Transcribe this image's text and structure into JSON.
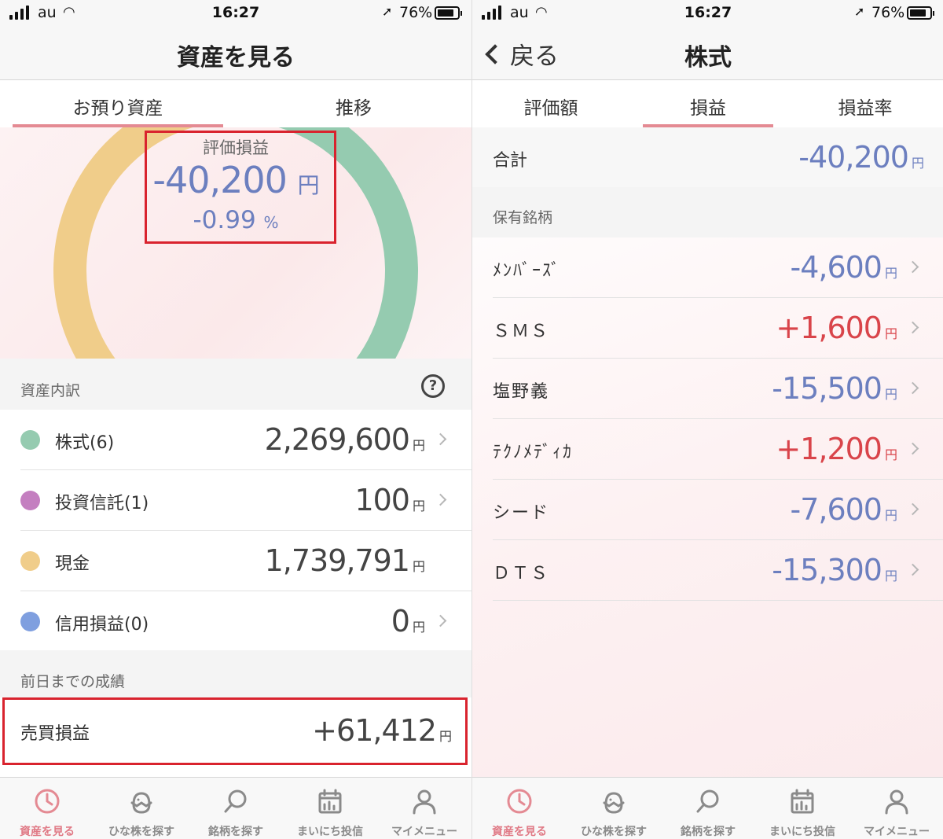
{
  "colors": {
    "accent": "#e48a93",
    "negative": "#6c7fbf",
    "positive": "#d9444a",
    "highlight_box": "#d9232e",
    "stocks": "#95cbb0",
    "funds": "#c47fc0",
    "cash": "#f0cd8a",
    "margin": "#7f9fdf"
  },
  "status": {
    "carrier": "au",
    "time": "16:27",
    "battery": "76%"
  },
  "left": {
    "title": "資産を見る",
    "tabs": [
      {
        "label": "お預り資産",
        "active": true
      },
      {
        "label": "推移",
        "active": false
      }
    ],
    "valuation": {
      "label": "評価損益",
      "amount": "-40,200",
      "unit": "円",
      "rate": "-0.99",
      "rate_unit": "%"
    },
    "donut": [
      {
        "name": "株式",
        "fraction": 0.566,
        "color": "#95cbb0"
      },
      {
        "name": "現金",
        "fraction": 0.434,
        "color": "#f0cd8a"
      }
    ],
    "breakdown": {
      "header": "資産内訳",
      "help_icon": "?",
      "items": [
        {
          "label": "株式(6)",
          "value": "2,269,600",
          "unit": "円",
          "color": "#95cbb0"
        },
        {
          "label": "投資信託(1)",
          "value": "100",
          "unit": "円",
          "color": "#c47fc0"
        },
        {
          "label": "現金",
          "value": "1,739,791",
          "unit": "円",
          "color": "#f0cd8a"
        },
        {
          "label": "信用損益(0)",
          "value": "0",
          "unit": "円",
          "color": "#7f9fdf"
        }
      ]
    },
    "results": {
      "header": "前日までの成績",
      "label": "売買損益",
      "value": "+61,412",
      "unit": "円"
    }
  },
  "right": {
    "back_label": "戻る",
    "title": "株式",
    "tabs": [
      {
        "label": "評価額",
        "active": false
      },
      {
        "label": "損益",
        "active": true
      },
      {
        "label": "損益率",
        "active": false
      }
    ],
    "total": {
      "label": "合計",
      "value": "-40,200",
      "unit": "円"
    },
    "holdings_header": "保有銘柄",
    "holdings": [
      {
        "name": "ﾒﾝﾊﾞｰｽﾞ",
        "value": "-4,600",
        "unit": "円",
        "sign": "neg"
      },
      {
        "name": "ＳＭＳ",
        "value": "+1,600",
        "unit": "円",
        "sign": "pos"
      },
      {
        "name": "塩野義",
        "value": "-15,500",
        "unit": "円",
        "sign": "neg"
      },
      {
        "name": "ﾃｸﾉﾒﾃﾞｨｶ",
        "value": "+1,200",
        "unit": "円",
        "sign": "pos"
      },
      {
        "name": "シード",
        "value": "-7,600",
        "unit": "円",
        "sign": "neg"
      },
      {
        "name": "ＤＴＳ",
        "value": "-15,300",
        "unit": "円",
        "sign": "neg"
      }
    ]
  },
  "tabbar": [
    {
      "label": "資産を見る",
      "icon": "clock-icon",
      "active": true
    },
    {
      "label": "ひな株を探す",
      "icon": "chick-icon",
      "active": false
    },
    {
      "label": "銘柄を探す",
      "icon": "search-icon",
      "active": false
    },
    {
      "label": "まいにち投信",
      "icon": "calendar-icon",
      "active": false
    },
    {
      "label": "マイメニュー",
      "icon": "person-icon",
      "active": false
    }
  ]
}
